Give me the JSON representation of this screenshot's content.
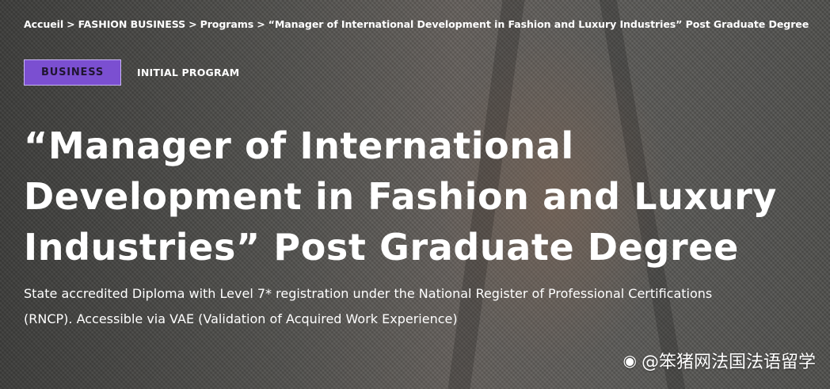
{
  "breadcrumb": {
    "items": [
      "Accueil",
      "FASHION BUSINESS",
      "Programs",
      "“Manager of International Development in Fashion and Luxury Industries” Post Graduate Degree"
    ],
    "separator": ">"
  },
  "tags": {
    "primary": "BUSINESS",
    "secondary": "INITIAL PROGRAM",
    "primary_color": "#7b4fd1"
  },
  "title": {
    "line1": "“Manager of International",
    "line2": "Development in Fashion and Luxury",
    "line3": "Industries” Post Graduate Degree"
  },
  "subtitle": {
    "line1": "State accredited Diploma with Level 7* registration under the National Register of Professional Certifications",
    "line2": "(RNCP). Accessible via VAE (Validation of Acquired Work Experience)"
  },
  "watermark": {
    "text": "@笨猪网法国法语留学",
    "icon": "weibo-icon"
  }
}
